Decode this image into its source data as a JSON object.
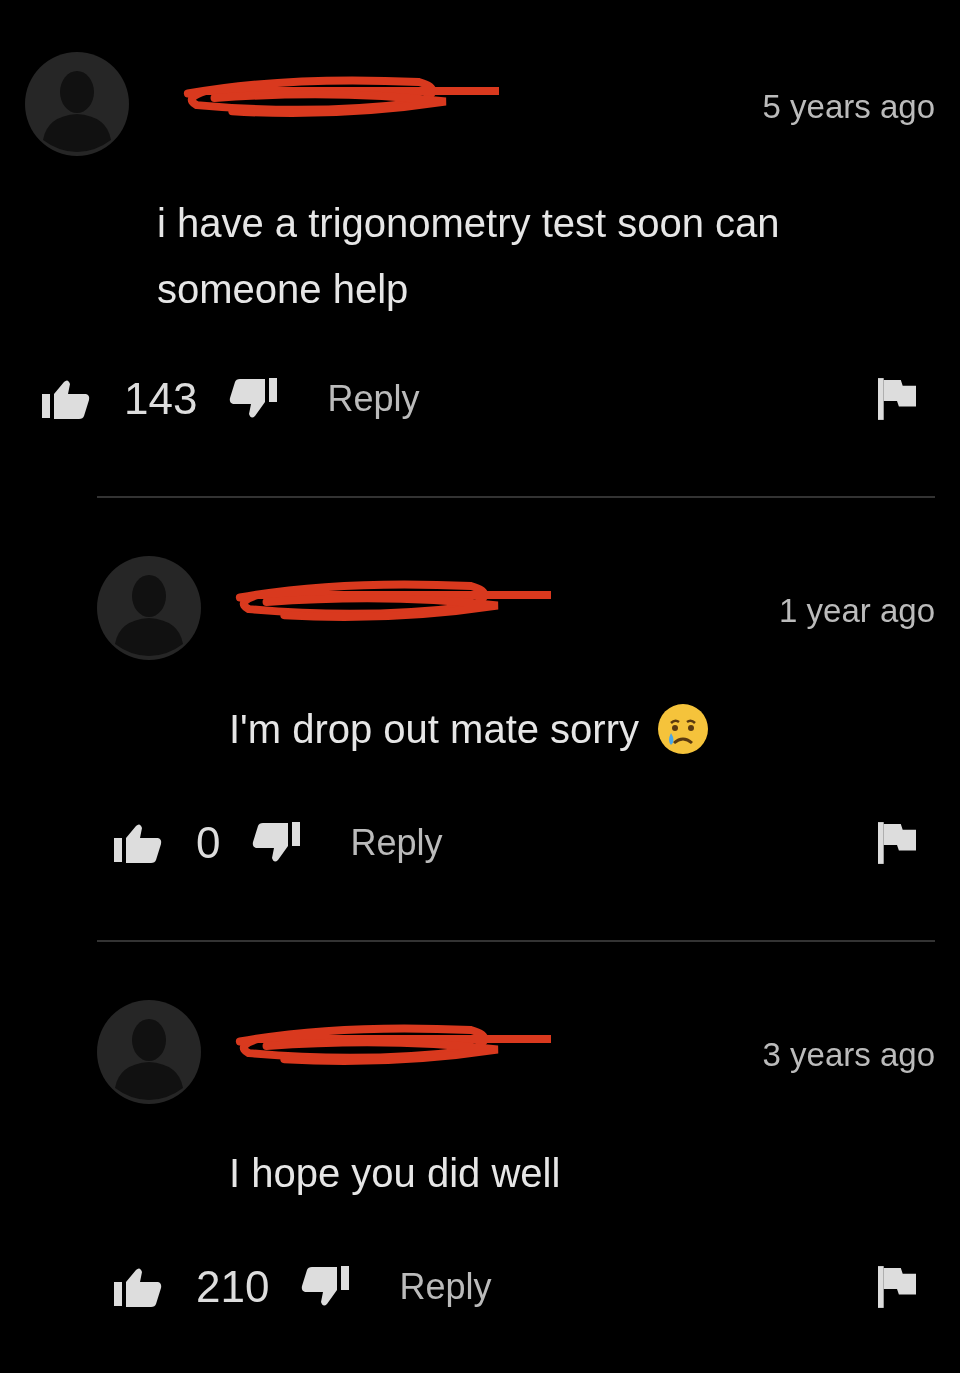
{
  "comments": [
    {
      "author_redacted": true,
      "time": "5 years ago",
      "text": "i have a trigonometry test soon can someone help",
      "emoji": false,
      "likes": "143",
      "reply_label": "Reply",
      "children": [
        {
          "author_redacted": true,
          "time": "1 year ago",
          "text": "I'm drop out mate sorry",
          "emoji": true,
          "likes": "0",
          "reply_label": "Reply"
        },
        {
          "author_redacted": true,
          "time": "3 years ago",
          "text": "I hope you did well",
          "emoji": false,
          "likes": "210",
          "reply_label": "Reply"
        }
      ]
    }
  ]
}
